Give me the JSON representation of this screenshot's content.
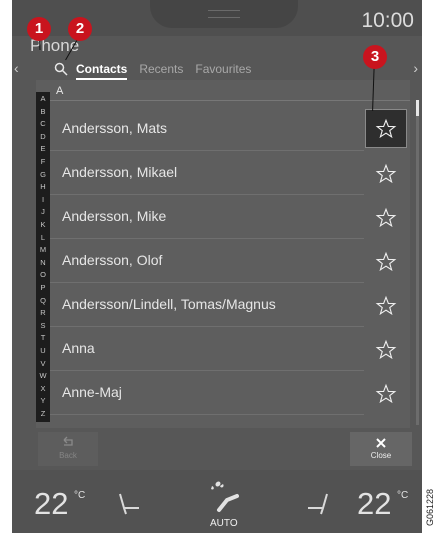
{
  "clock": "10:00",
  "app": {
    "title": "Phone"
  },
  "tabs": {
    "contacts": "Contacts",
    "recents": "Recents",
    "favourites": "Favourites"
  },
  "section": "A",
  "alphabet": [
    "A",
    "B",
    "C",
    "D",
    "E",
    "F",
    "G",
    "H",
    "I",
    "J",
    "K",
    "L",
    "M",
    "N",
    "O",
    "P",
    "Q",
    "R",
    "S",
    "T",
    "U",
    "V",
    "W",
    "X",
    "Y",
    "Z"
  ],
  "contacts": [
    {
      "name": "Andersson, Mats",
      "favorite": true
    },
    {
      "name": "Andersson, Mikael",
      "favorite": false
    },
    {
      "name": "Andersson, Mike",
      "favorite": false
    },
    {
      "name": "Andersson, Olof",
      "favorite": false
    },
    {
      "name": "Andersson/Lindell, Tomas/Magnus",
      "favorite": false
    },
    {
      "name": "Anna",
      "favorite": false
    },
    {
      "name": "Anne-Maj",
      "favorite": false
    }
  ],
  "buttons": {
    "back": "Back",
    "close": "Close"
  },
  "climate": {
    "left_temp": "22",
    "right_temp": "22",
    "unit": "°C",
    "mode": "AUTO"
  },
  "callouts": [
    "1",
    "2",
    "3"
  ],
  "image_code": "G061228",
  "colors": {
    "callout": "#c9141e",
    "screen": "#575757",
    "list": "#5e5e5e"
  }
}
